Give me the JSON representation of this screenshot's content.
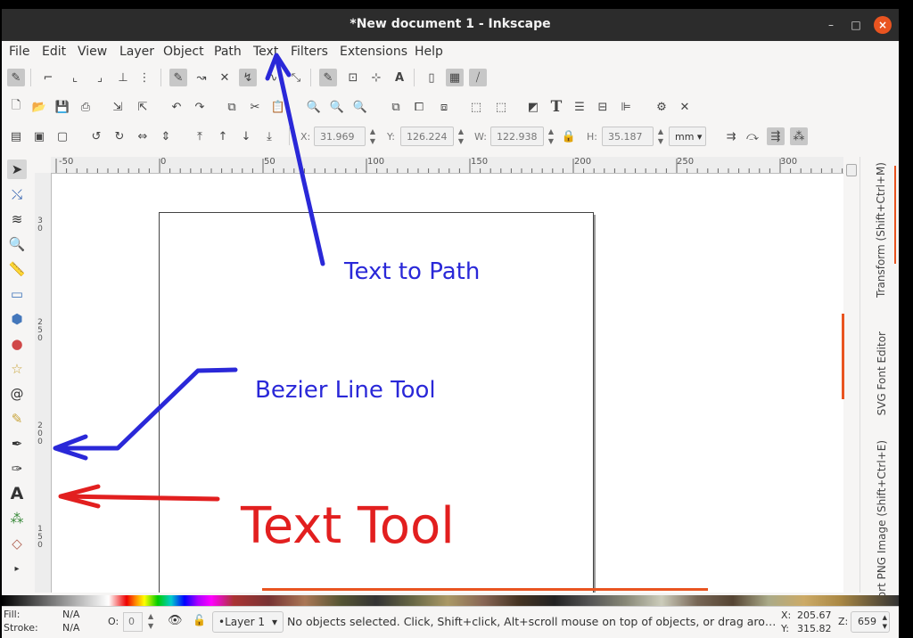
{
  "window": {
    "title": "*New document 1 - Inkscape",
    "minimize_glyph": "–",
    "maximize_glyph": "□",
    "close_glyph": "×"
  },
  "menubar": {
    "items": [
      "File",
      "Edit",
      "View",
      "Layer",
      "Object",
      "Path",
      "Text",
      "Filters",
      "Extensions",
      "Help"
    ]
  },
  "toolbar_controls": {
    "x_label": "X:",
    "x_value": "31.969",
    "y_label": "Y:",
    "y_value": "126.224",
    "w_label": "W:",
    "w_value": "122.938",
    "h_label": "H:",
    "h_value": "35.187",
    "unit": "mm"
  },
  "ruler_top": {
    "labels": [
      "-50",
      "0",
      "50",
      "100",
      "150",
      "200",
      "250",
      "300"
    ]
  },
  "ruler_left": {
    "labels": [
      "3\n0",
      "2\n5\n0",
      "2\n0\n0",
      "1\n5\n0"
    ]
  },
  "dock": {
    "tabs": [
      "Transform (Shift+Ctrl+M)",
      "SVG Font Editor",
      "Export PNG Image (Shift+Ctrl+E)"
    ]
  },
  "statusbar": {
    "fill_label": "Fill:",
    "fill_value": "N/A",
    "stroke_label": "Stroke:",
    "stroke_value": "N/A",
    "opacity_label": "O:",
    "opacity_value": "0",
    "layer": "•Layer 1",
    "message": "No objects selected. Click, Shift+click, Alt+scroll mouse on top of objects, or drag aro…",
    "cursor_x_label": "X:",
    "cursor_x": "205.67",
    "cursor_y_label": "Y:",
    "cursor_y": "315.82",
    "zoom_label": "Z:",
    "zoom": "659"
  },
  "annotations": {
    "text_to_path": "Text to Path",
    "bezier_line_tool": "Bezier Line Tool",
    "text_tool": "Text Tool",
    "blue": "#2a28d8",
    "red": "#e21f1f"
  },
  "accent": "#e95420"
}
